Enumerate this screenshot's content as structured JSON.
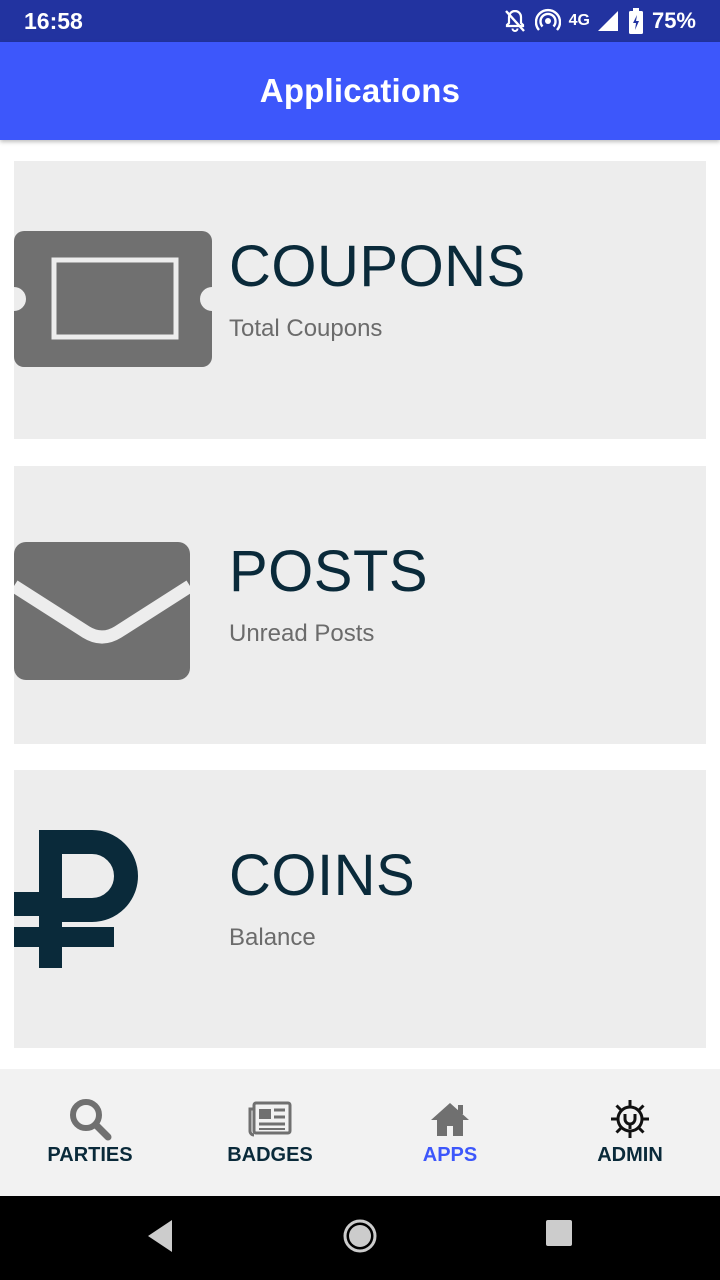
{
  "status_bar": {
    "time": "16:58",
    "network": "4G",
    "battery": "75%",
    "icons": [
      "notifications-off-icon",
      "hotspot-icon",
      "signal-icon",
      "battery-charging-icon"
    ]
  },
  "app_bar": {
    "title": "Applications"
  },
  "cards": [
    {
      "title": "COUPONS",
      "subtitle": "Total Coupons",
      "icon": "ticket-icon"
    },
    {
      "title": "POSTS",
      "subtitle": "Unread Posts",
      "icon": "envelope-icon"
    },
    {
      "title": "COINS",
      "subtitle": "Balance",
      "icon": "ruble-icon"
    }
  ],
  "bottom_nav": {
    "items": [
      {
        "label": "PARTIES",
        "icon": "search-icon",
        "active": false
      },
      {
        "label": "BADGES",
        "icon": "newspaper-icon",
        "active": false
      },
      {
        "label": "APPS",
        "icon": "home-icon",
        "active": true
      },
      {
        "label": "ADMIN",
        "icon": "gear-icon",
        "active": false
      }
    ]
  },
  "system_nav": {
    "buttons": [
      "back-icon",
      "home-circle-icon",
      "recents-icon"
    ]
  },
  "colors": {
    "status_bar": "#2233a0",
    "app_bar": "#3d57fb",
    "card_background": "#ededed",
    "card_title": "#0a2a3a",
    "card_subtitle": "#6b6b6b",
    "icon_gray": "#707070",
    "active_nav": "#3d57fb"
  }
}
